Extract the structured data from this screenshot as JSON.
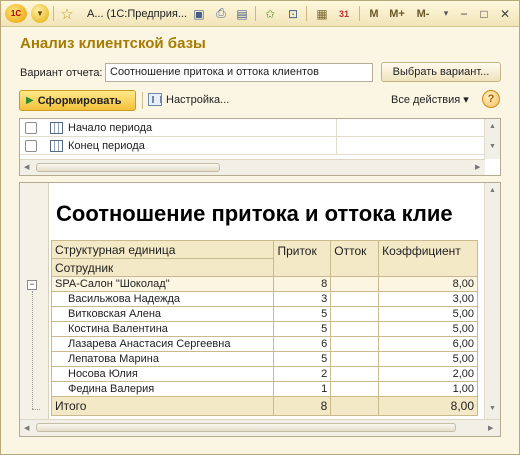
{
  "titlebar": {
    "logo_text": "1С",
    "title": "А...  (1С:Предприя...",
    "memory_buttons": [
      "M",
      "M+",
      "M-"
    ],
    "icons": [
      "dropdown-icon",
      "star-icon",
      "save-icon",
      "print-icon",
      "preview-icon",
      "favorite-add-icon",
      "favorites-icon",
      "calculator-icon",
      "calendar-icon",
      "minimize-icon",
      "restore-icon",
      "close-icon"
    ],
    "calendar_day": "31"
  },
  "form": {
    "title": "Анализ клиентской базы",
    "variant_label": "Вариант отчета:",
    "variant_value": "Соотношение притока и оттока клиентов",
    "select_variant_button": "Выбрать вариант...",
    "run_button": "Сформировать",
    "settings_button": "Настройка...",
    "all_actions": "Все действия ▾",
    "help": "?"
  },
  "params": [
    {
      "label": "Начало периода",
      "checked": false
    },
    {
      "label": "Конец периода",
      "checked": false
    }
  ],
  "report": {
    "title": "Соотношение притока и оттока клие",
    "headers": {
      "unit": "Структурная единица",
      "employee": "Сотрудник",
      "inflow": "Приток",
      "outflow": "Отток",
      "ratio": "Коэффициент"
    },
    "group": {
      "name": "SPA-Салон \"Шоколад\"",
      "inflow": "8",
      "outflow": "",
      "ratio": "8,00"
    },
    "rows": [
      {
        "name": "Васильжова Надежда",
        "inflow": "3",
        "outflow": "",
        "ratio": "3,00"
      },
      {
        "name": "Витковская Алена",
        "inflow": "5",
        "outflow": "",
        "ratio": "5,00"
      },
      {
        "name": "Костина Валентина",
        "inflow": "5",
        "outflow": "",
        "ratio": "5,00"
      },
      {
        "name": "Лазарева Анастасия Сергеевна",
        "inflow": "6",
        "outflow": "",
        "ratio": "6,00"
      },
      {
        "name": "Лепатова Марина",
        "inflow": "5",
        "outflow": "",
        "ratio": "5,00"
      },
      {
        "name": "Носова Юлия",
        "inflow": "2",
        "outflow": "",
        "ratio": "2,00"
      },
      {
        "name": "Федина Валерия",
        "inflow": "1",
        "outflow": "",
        "ratio": "1,00"
      }
    ],
    "total": {
      "label": "Итого",
      "inflow": "8",
      "outflow": "",
      "ratio": "8,00"
    }
  }
}
